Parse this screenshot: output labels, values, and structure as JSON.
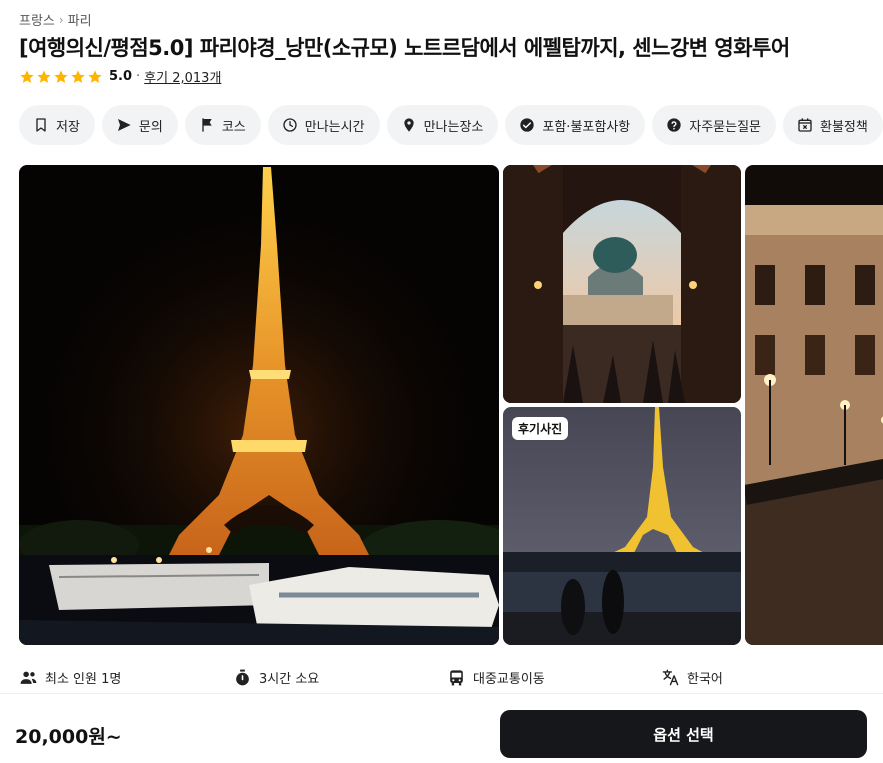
{
  "breadcrumb": {
    "country": "프랑스",
    "city": "파리"
  },
  "title": "[여행의신/평점5.0] 파리야경_낭만(소규모) 노트르담에서 에펠탑까지, 센느강변 영화투어",
  "rating": {
    "score": "5.0",
    "separator": "·",
    "reviews": "후기 2,013개",
    "star_color": "#FFB400",
    "star_count": 5
  },
  "chips": [
    {
      "label": "저장",
      "icon": "bookmark-icon"
    },
    {
      "label": "문의",
      "icon": "send-icon"
    },
    {
      "label": "코스",
      "icon": "flag-icon"
    },
    {
      "label": "만나는시간",
      "icon": "clock-icon"
    },
    {
      "label": "만나는장소",
      "icon": "location-pin-icon"
    },
    {
      "label": "포함·불포함사항",
      "icon": "check-circle-icon"
    },
    {
      "label": "자주묻는질문",
      "icon": "question-circle-icon"
    },
    {
      "label": "환불정책",
      "icon": "calendar-x-icon"
    }
  ],
  "gallery": {
    "review_badge": "후기사진",
    "images": [
      "eiffel-tower-night-photo",
      "arch-institut-de-france-photo",
      "eiffel-tower-review-photo",
      "pont-des-arts-night-photo"
    ]
  },
  "info": [
    {
      "label": "최소 인원 1명",
      "icon": "users-icon"
    },
    {
      "label": "3시간 소요",
      "icon": "timer-icon"
    },
    {
      "label": "대중교통이동",
      "icon": "bus-icon"
    },
    {
      "label": "한국어",
      "icon": "translate-icon"
    }
  ],
  "footer": {
    "price": "20,000원~",
    "cta_label": "옵션 선택",
    "cta_color": "#15171A"
  }
}
